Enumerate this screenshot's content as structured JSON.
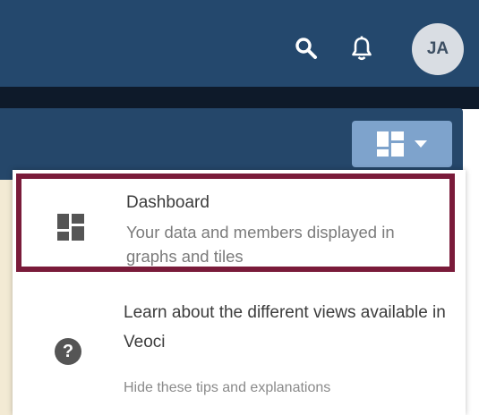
{
  "header": {
    "avatar_initials": "JA",
    "icons": {
      "search": "search-icon",
      "notifications": "bell-icon"
    }
  },
  "view_switcher": {
    "icon": "dashboard-layout-icon",
    "caret": "caret-down-icon"
  },
  "menu": {
    "dashboard": {
      "title": "Dashboard",
      "description": "Your data and members displayed in graphs and tiles",
      "icon": "dashboard-layout-icon"
    },
    "learn": {
      "text": "Learn about the different views available in Veoci",
      "icon": "question-circle-icon",
      "icon_glyph": "?"
    },
    "hide_tips_label": "Hide these tips and explanations"
  },
  "colors": {
    "header_bg": "#24486d",
    "panel_bg": "#25476a",
    "view_button_bg": "#7ea3cc",
    "highlight_border": "#7a1b3a"
  }
}
